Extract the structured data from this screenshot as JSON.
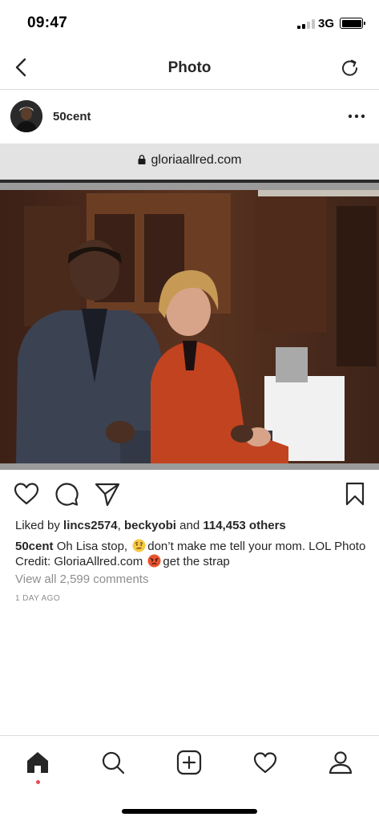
{
  "status_bar": {
    "time": "09:47",
    "network": "3G"
  },
  "nav": {
    "title": "Photo"
  },
  "post": {
    "username": "50cent",
    "url": "gloriaallred.com",
    "liked_by_prefix": "Liked by ",
    "liked_user_1": "lincs2574",
    "liked_separator": ", ",
    "liked_user_2": "beckyobi",
    "liked_and": " and ",
    "liked_others": "114,453 others",
    "caption_user": "50cent",
    "caption_part_1": " Oh Lisa stop, ",
    "caption_part_2": "don’t make me tell your mom. LOL Photo Credit: GloriaAllred.com ",
    "caption_part_3": "get the strap",
    "comments_link": "View all 2,599 comments",
    "time_ago": "1 DAY AGO"
  },
  "icons": {
    "back": "chevron-left-icon",
    "refresh": "refresh-icon",
    "more": "more-horizontal-icon",
    "like": "heart-icon",
    "comment": "comment-icon",
    "share": "paper-plane-icon",
    "save": "bookmark-icon",
    "emoji_1": "face-with-raised-eyebrow-emoji",
    "emoji_2": "angry-face-emoji",
    "tabs": [
      "home-icon",
      "search-icon",
      "add-post-icon",
      "activity-heart-icon",
      "profile-icon"
    ]
  },
  "colors": {
    "notification_dot": "#ed4956",
    "text": "#262626",
    "muted": "#8e8e8e",
    "divider": "#dbdbdb"
  }
}
